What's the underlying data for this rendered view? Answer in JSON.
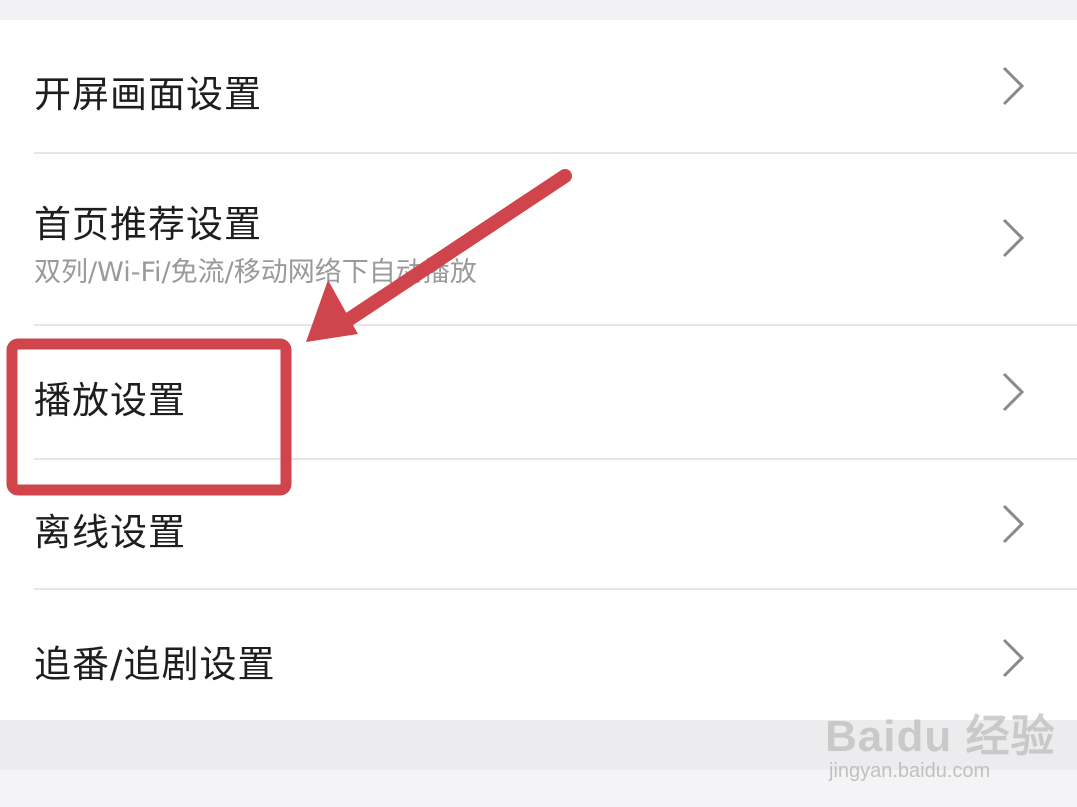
{
  "settings": {
    "items": [
      {
        "title": "开屏画面设置",
        "subtitle": ""
      },
      {
        "title": "首页推荐设置",
        "subtitle": "双列/Wi-Fi/免流/移动网络下自动播放"
      },
      {
        "title": "播放设置",
        "subtitle": ""
      },
      {
        "title": "离线设置",
        "subtitle": ""
      },
      {
        "title": "追番/追剧设置",
        "subtitle": ""
      }
    ]
  },
  "annotation": {
    "color": "#d0444b",
    "highlighted_item": "播放设置"
  },
  "watermark": {
    "logo_text": "Baidu 经验",
    "url": "jingyan.baidu.com"
  }
}
